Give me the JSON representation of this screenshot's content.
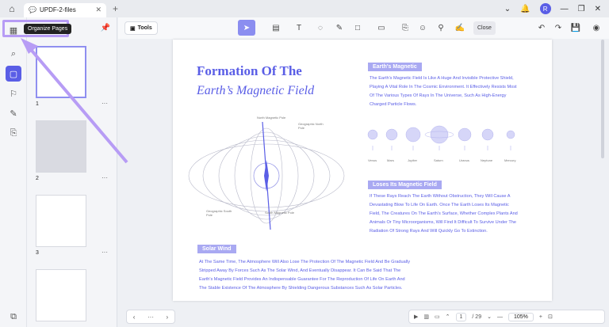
{
  "titlebar": {
    "tab_title": "UPDF-2-files",
    "avatar_initial": "R"
  },
  "sidebar": {
    "tooltip": "Organize Pages",
    "thumbnails": [
      "1",
      "2",
      "3"
    ]
  },
  "toolbar": {
    "tools_label": "Tools",
    "close_label": "Close"
  },
  "page": {
    "title_line1": "Formation Of The",
    "title_line2": "Earth’s Magnetic Field",
    "section1": {
      "heading": "Earth's Magnetic",
      "text": [
        "The Earth's Magnetic Field Is Like A Huge And Invisible Protective Shield,",
        "Playing A Vital Role In The Cosmic Environment. It Effectively Resists Most",
        "Of The Various Types Of Rays In The Universe, Such As High-Energy",
        "Charged Particle Flows."
      ]
    },
    "planets": [
      "Venus",
      "Mars",
      "Jupiter",
      "Saturn",
      "Uranus",
      "Neptune",
      "Mercury"
    ],
    "diagram_labels": {
      "north_magnetic": "North Magnetic Pole",
      "geo_north": "Geographic North Pole",
      "geo_south": "Geographic South Pole",
      "south_magnetic": "South Magnetic Pole"
    },
    "section2": {
      "heading": "Loses Its Magnetic Field",
      "text": [
        "If These Rays Reach The Earth Without Obstruction, They Will Cause A",
        "Devastating Blow To Life On Earth. Once The Earth Loses Its Magnetic",
        "Field, The Creatures On The Earth's Surface, Whether Complex Plants And",
        "Animals Or Tiny Microorganisms, Will Find It Difficult To Survive Under The",
        "Radiation Of Strong Rays And Will Quickly Go To Extinction."
      ]
    },
    "section3": {
      "heading": "Solar Wind",
      "text": [
        "At The Same Time, The Atmosphere Will Also Lose The Protection Of The Magnetic Field And Be Gradually",
        "Stripped Away By Forces Such As The Solar Wind, And Eventually Disappear. It Can Be Said That The",
        "Earth's Magnetic Field Provides An Indispensable Guarantee For The Reproduction Of Life On Earth And",
        "The Stable Existence Of The Atmosphere By Shielding Dangerous Substances Such As Solar Particles."
      ]
    }
  },
  "bottom": {
    "page_current": "1",
    "page_total": "/ 29",
    "zoom": "105%"
  },
  "colors": {
    "accent": "#5a5ee6",
    "highlight": "#b79cf5"
  }
}
